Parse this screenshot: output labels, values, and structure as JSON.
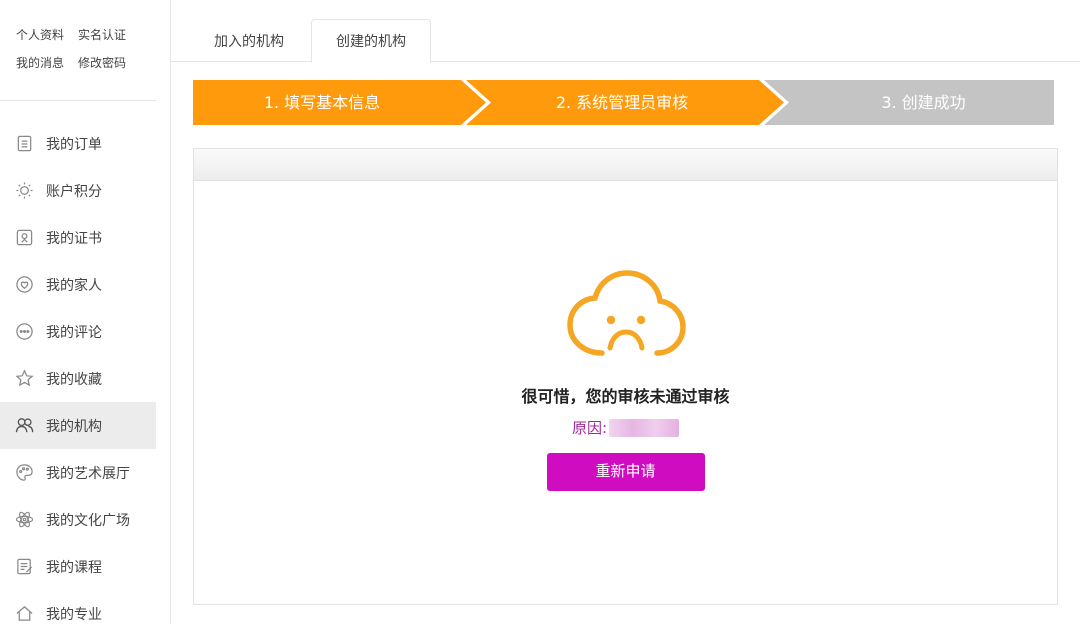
{
  "sidebar": {
    "quick_links": [
      [
        "个人资料",
        "实名认证"
      ],
      [
        "我的消息",
        "修改密码"
      ]
    ],
    "menu": [
      {
        "label": "我的订单",
        "icon": "order-list-icon"
      },
      {
        "label": "账户积分",
        "icon": "lightbulb-icon"
      },
      {
        "label": "我的证书",
        "icon": "certificate-icon"
      },
      {
        "label": "我的家人",
        "icon": "heart-icon"
      },
      {
        "label": "我的评论",
        "icon": "comment-icon"
      },
      {
        "label": "我的收藏",
        "icon": "star-icon"
      },
      {
        "label": "我的机构",
        "icon": "people-icon",
        "active": true
      },
      {
        "label": "我的艺术展厅",
        "icon": "palette-icon"
      },
      {
        "label": "我的文化广场",
        "icon": "atom-icon"
      },
      {
        "label": "我的课程",
        "icon": "course-icon"
      },
      {
        "label": "我的专业",
        "icon": "home-icon"
      }
    ]
  },
  "tabs": {
    "joined": "加入的机构",
    "created": "创建的机构",
    "active": "created"
  },
  "steps": [
    {
      "label": "1. 填写基本信息",
      "state": "done"
    },
    {
      "label": "2. 系统管理员审核",
      "state": "current"
    },
    {
      "label": "3. 创建成功",
      "state": "pending"
    }
  ],
  "colors": {
    "step_active": "#ff9a0d",
    "step_pending": "#c4c4c4",
    "icon_orange": "#f5a623",
    "reason_text": "#a0279a",
    "button": "#cf0cc0"
  },
  "result": {
    "icon": "sad-cloud-icon",
    "message": "很可惜，您的审核未通过审核",
    "reason_label": "原因:",
    "button_label": "重新申请"
  }
}
